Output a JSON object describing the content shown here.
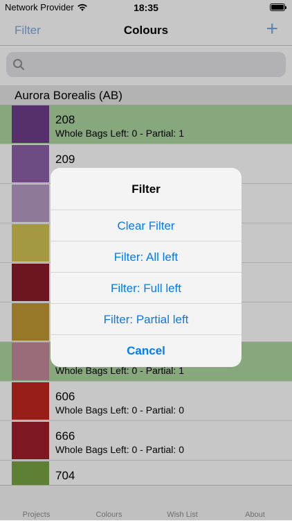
{
  "status": {
    "carrier": "Network Provider",
    "time": "18:35"
  },
  "nav": {
    "left": "Filter",
    "title": "Colours",
    "add": "+"
  },
  "search": {
    "placeholder": ""
  },
  "section": {
    "title": "Aurora Borealis (AB)"
  },
  "rows": [
    {
      "code": "208",
      "detail": "Whole Bags Left: 0 - Partial: 1",
      "color": "#6f3e8c",
      "highlight": "#aed6a1"
    },
    {
      "code": "209",
      "detail": "",
      "color": "#8e62a8",
      "highlight": "#ffffff"
    },
    {
      "code": "",
      "detail": "",
      "color": "#b89bc7",
      "highlight": "#ffffff"
    },
    {
      "code": "",
      "detail": "",
      "color": "#d2c554",
      "highlight": "#ffffff"
    },
    {
      "code": "",
      "detail": "",
      "color": "#8c1d2b",
      "highlight": "#ffffff"
    },
    {
      "code": "",
      "detail": "",
      "color": "#c29a35",
      "highlight": "#ffffff"
    },
    {
      "code": "",
      "detail": "Whole Bags Left: 0 - Partial: 1",
      "color": "#c68b9b",
      "highlight": "#aed6a1"
    },
    {
      "code": "606",
      "detail": "Whole Bags Left: 0 - Partial: 0",
      "color": "#c1271e",
      "highlight": "#ffffff"
    },
    {
      "code": "666",
      "detail": "Whole Bags Left: 0 - Partial: 0",
      "color": "#a01f2c",
      "highlight": "#ffffff"
    },
    {
      "code": "704",
      "detail": "",
      "color": "#79a444",
      "highlight": "#ffffff"
    }
  ],
  "tabs": [
    "Projects",
    "Colours",
    "Wish List",
    "About"
  ],
  "dialog": {
    "title": "Filter",
    "options": [
      "Clear Filter",
      "Filter: All left",
      "Filter: Full left",
      "Filter: Partial left"
    ],
    "cancel": "Cancel"
  },
  "colors": {
    "accent": "#007aff",
    "nav_disabled": "#7aa9e0"
  }
}
